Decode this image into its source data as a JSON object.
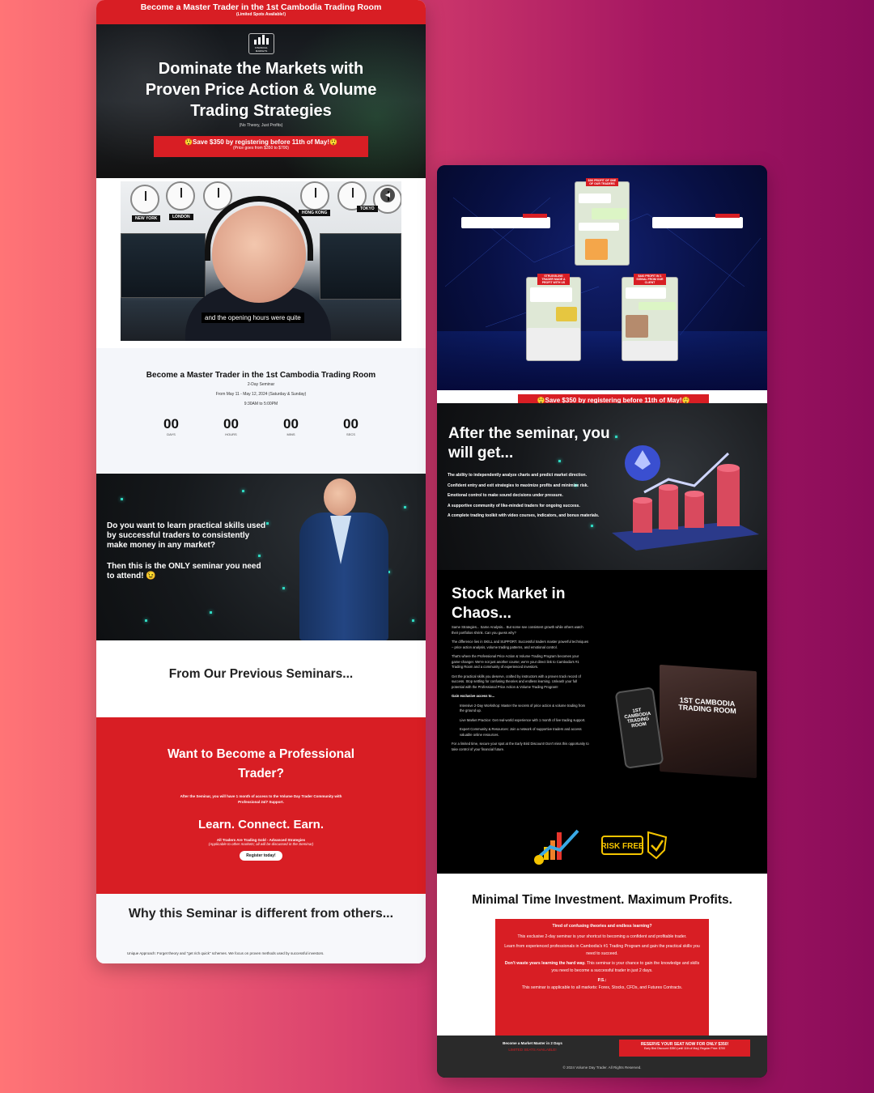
{
  "left": {
    "topbar": {
      "title": "Become a Master Trader in the 1st Cambodia Trading Room",
      "subtitle": "(Limited Spots Available!)"
    },
    "hero": {
      "logo_text": "FINANCIAL MARKETS",
      "headline": "Dominate the Markets with Proven Price Action & Volume Trading Strategies",
      "subline": "(No Theory, Just Profits)",
      "save_text": "😲Save $350 by registering before 11th of May!😲",
      "save_note": "(Price goes from $350 to $700)"
    },
    "video": {
      "cities": [
        "NEW YORK",
        "LONDON",
        "HONG KONG",
        "TOKYO"
      ],
      "caption": "and the opening hours were quite",
      "mute_icon": "speaker-icon"
    },
    "countdown": {
      "heading": "Become a Master Trader in the 1st Cambodia Trading Room",
      "kind": "2-Day Seminar",
      "dates": "From May 11 - May 12, 2024 (Saturday & Sunday)",
      "hours": "9:30AM to 5:00PM",
      "units": [
        {
          "value": "00",
          "label": "DAYS"
        },
        {
          "value": "00",
          "label": "HOURS"
        },
        {
          "value": "00",
          "label": "MINS"
        },
        {
          "value": "00",
          "label": "SECS"
        }
      ]
    },
    "ask": {
      "question": "Do you want to learn practical skills used by successful traders to consistently make money in any market?",
      "answer": "Then this is the ONLY seminar you need to attend! 😉"
    },
    "previous": {
      "heading": "From Our Previous Seminars..."
    },
    "pro": {
      "heading": "Want to Become a Professional Trader?",
      "text": "After the Seminar, you will have 1 month of access to the Volume Day Trader Community with Professional 24/7 Support.",
      "slogan": "Learn. Connect. Earn.",
      "note": "All Traders Are Trading Gold - Advanced Strategies",
      "note2": "(Applicable to other markets; all will be discussed in the Seminar)",
      "button": "Register today!"
    },
    "why": {
      "heading": "Why this Seminar is different from others...",
      "point": "Unique Approach: Forget theory and \"get rich quick\" schemes. We focus on proven methods used by successful investors."
    }
  },
  "right": {
    "proof": {
      "tags": [
        "$3K PROFIT OF ONE OF OUR TRADERS",
        "STRUGGLING TRADER MADE A PROFIT WITH US",
        "$440 PROFIT IN 1 SIGNAL FROM OUR CLIENT"
      ]
    },
    "save": {
      "text": "😲Save $350 by registering before 11th of May!😲",
      "note": "(Price goes from $350 to $700)"
    },
    "after": {
      "heading": "After the seminar, you will get...",
      "items": [
        "The ability to independently analyze charts and predict market direction.",
        "Confident entry and exit strategies to maximize profits and minimize risk.",
        "Emotional control to make sound decisions under pressure.",
        "A supportive community of like-minded traders for ongoing success.",
        "A complete trading toolkit with video courses, indicators, and bonus materials."
      ]
    },
    "stock": {
      "heading": "Stock Market in Chaos...",
      "p1": "Same Strategies... Same Analysis... But some see consistent growth while others watch their portfolios shrink. Can you guess why?",
      "p2": "The difference lies in SKILL and SUPPORT. Successful traders master powerful techniques – price action analysis, volume trading patterns, and emotional control.",
      "p3": "That's where the Professional Price Action & Volume Trading Program becomes your game-changer. We're not just another course; we're your direct link to Cambodia's #1 Trading Room and a community of experienced investors.",
      "p4": "Get the practical skills you deserve, crafted by instructors with a proven track record of success. Stop settling for confusing theories and endless learning. Unleash your full potential with the Professional Price Action & Volume Trading Program!",
      "p5": "Gain exclusive access to...",
      "b1": "Intensive 2-Day Workshop: Master the secrets of price action & volume trading from the ground up.",
      "b2": "Live Market Practice: Get real-world experience with 1 month of live trading support.",
      "b3": "Expert Community & Resources: Join a network of supportive traders and access valuable online resources.",
      "p6": "For a limited time, secure your spot at the Early Bird Discount! Don't miss this opportunity to take control of your financial future.",
      "book_title": "1ST CAMBODIA TRADING ROOM",
      "phone_title": "1ST CAMBODIA TRADING ROOM",
      "risk_badge": "RISK FREE"
    },
    "minimal": {
      "heading": "Minimal Time Investment. Maximum Profits.",
      "q": "Tired of confusing theories and endless learning?",
      "p1": "This exclusive 2-day seminar is your shortcut to becoming a confident and profitable trader.",
      "p2": "Learn from experienced professionals in Cambodia's #1 Trading Program and gain the practical skills you need to succeed.",
      "p3a": "Don't waste years learning the hard way.",
      "p3b": "This seminar is your chance to gain the knowledge and skills you need to become a successful trader in just 2 days.",
      "ps": "P.S.:",
      "p4": "This seminar is applicable to all markets: Forex, Stocks, CFDs, and Futures Contracts."
    },
    "footer": {
      "line1": "Become a Market Master in 2 Days",
      "line2": "LIMITED SEATS AVAILABLE!",
      "cta": "RESERVE YOUR SEAT NOW FOR ONLY $350!",
      "cta_note": "Early Bird Discount: $350 (until 11th of May) Regular Price: $700",
      "copyright": "© 2024 Volume Day Trader. All Rights Reserved."
    }
  },
  "colors": {
    "accent_red": "#d81e24",
    "background_gradient_start": "#ff7476",
    "background_gradient_end": "#8a0c5a"
  }
}
